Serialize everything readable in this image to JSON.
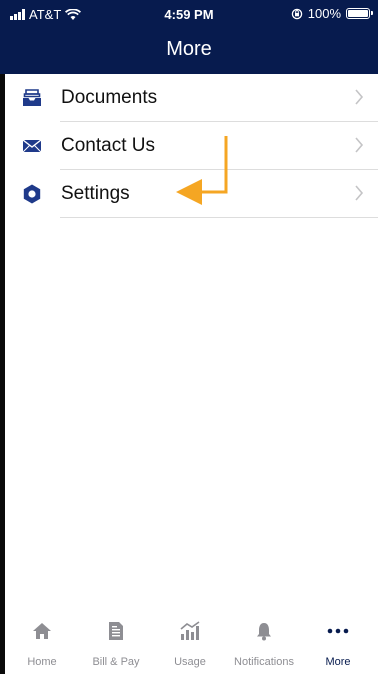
{
  "status_bar": {
    "carrier": "AT&T",
    "time": "4:59 PM",
    "battery": "100%"
  },
  "header": {
    "title": "More"
  },
  "menu": {
    "items": [
      {
        "label": "Documents",
        "icon": "documents-tray-icon"
      },
      {
        "label": "Contact Us",
        "icon": "envelope-icon"
      },
      {
        "label": "Settings",
        "icon": "gear-icon"
      }
    ]
  },
  "annotation": {
    "icon": "arrow-pointing-left-icon",
    "color": "#f5a623"
  },
  "tab_bar": {
    "active": "More",
    "tabs": [
      {
        "label": "Home",
        "icon": "home-icon"
      },
      {
        "label": "Bill & Pay",
        "icon": "bill-icon"
      },
      {
        "label": "Usage",
        "icon": "usage-chart-icon"
      },
      {
        "label": "Notifications",
        "icon": "bell-icon"
      },
      {
        "label": "More",
        "icon": "more-dots-icon"
      }
    ]
  },
  "colors": {
    "header": "#071b4e",
    "icon": "#1f3a8a",
    "active_tab": "#071b4e",
    "inactive_tab": "#8e8e93"
  }
}
